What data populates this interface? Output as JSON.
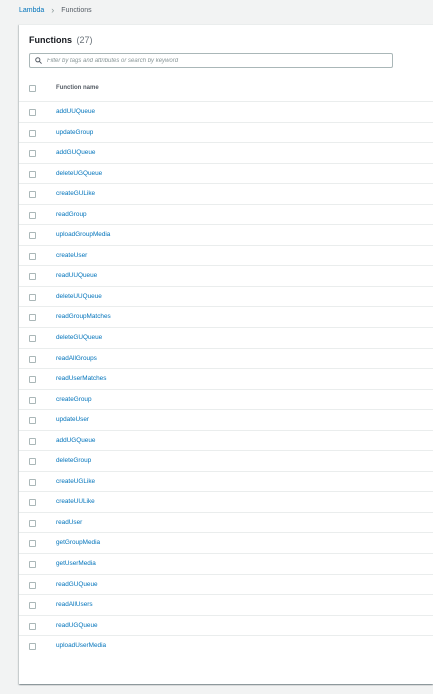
{
  "breadcrumb": {
    "root": "Lambda",
    "current": "Functions"
  },
  "panel": {
    "title": "Functions",
    "count": "(27)"
  },
  "search": {
    "placeholder": "Filter by tags and attributes or search by keyword",
    "value": ""
  },
  "table": {
    "column_header": "Function name",
    "rows": [
      "addUUQueue",
      "updateGroup",
      "addGUQueue",
      "deleteUGQueue",
      "createGULike",
      "readGroup",
      "uploadGroupMedia",
      "createUser",
      "readUUQueue",
      "deleteUUQueue",
      "readGroupMatches",
      "deleteGUQueue",
      "readAllGroups",
      "readUserMatches",
      "createGroup",
      "updateUser",
      "addUGQueue",
      "deleteGroup",
      "createUGLike",
      "createUULike",
      "readUser",
      "getGroupMedia",
      "getUserMedia",
      "readGUQueue",
      "readAllUsers",
      "readUGQueue",
      "uploadUserMedia"
    ]
  },
  "colors": {
    "link": "#0073bb",
    "background": "#f2f3f3",
    "panel": "#ffffff"
  }
}
